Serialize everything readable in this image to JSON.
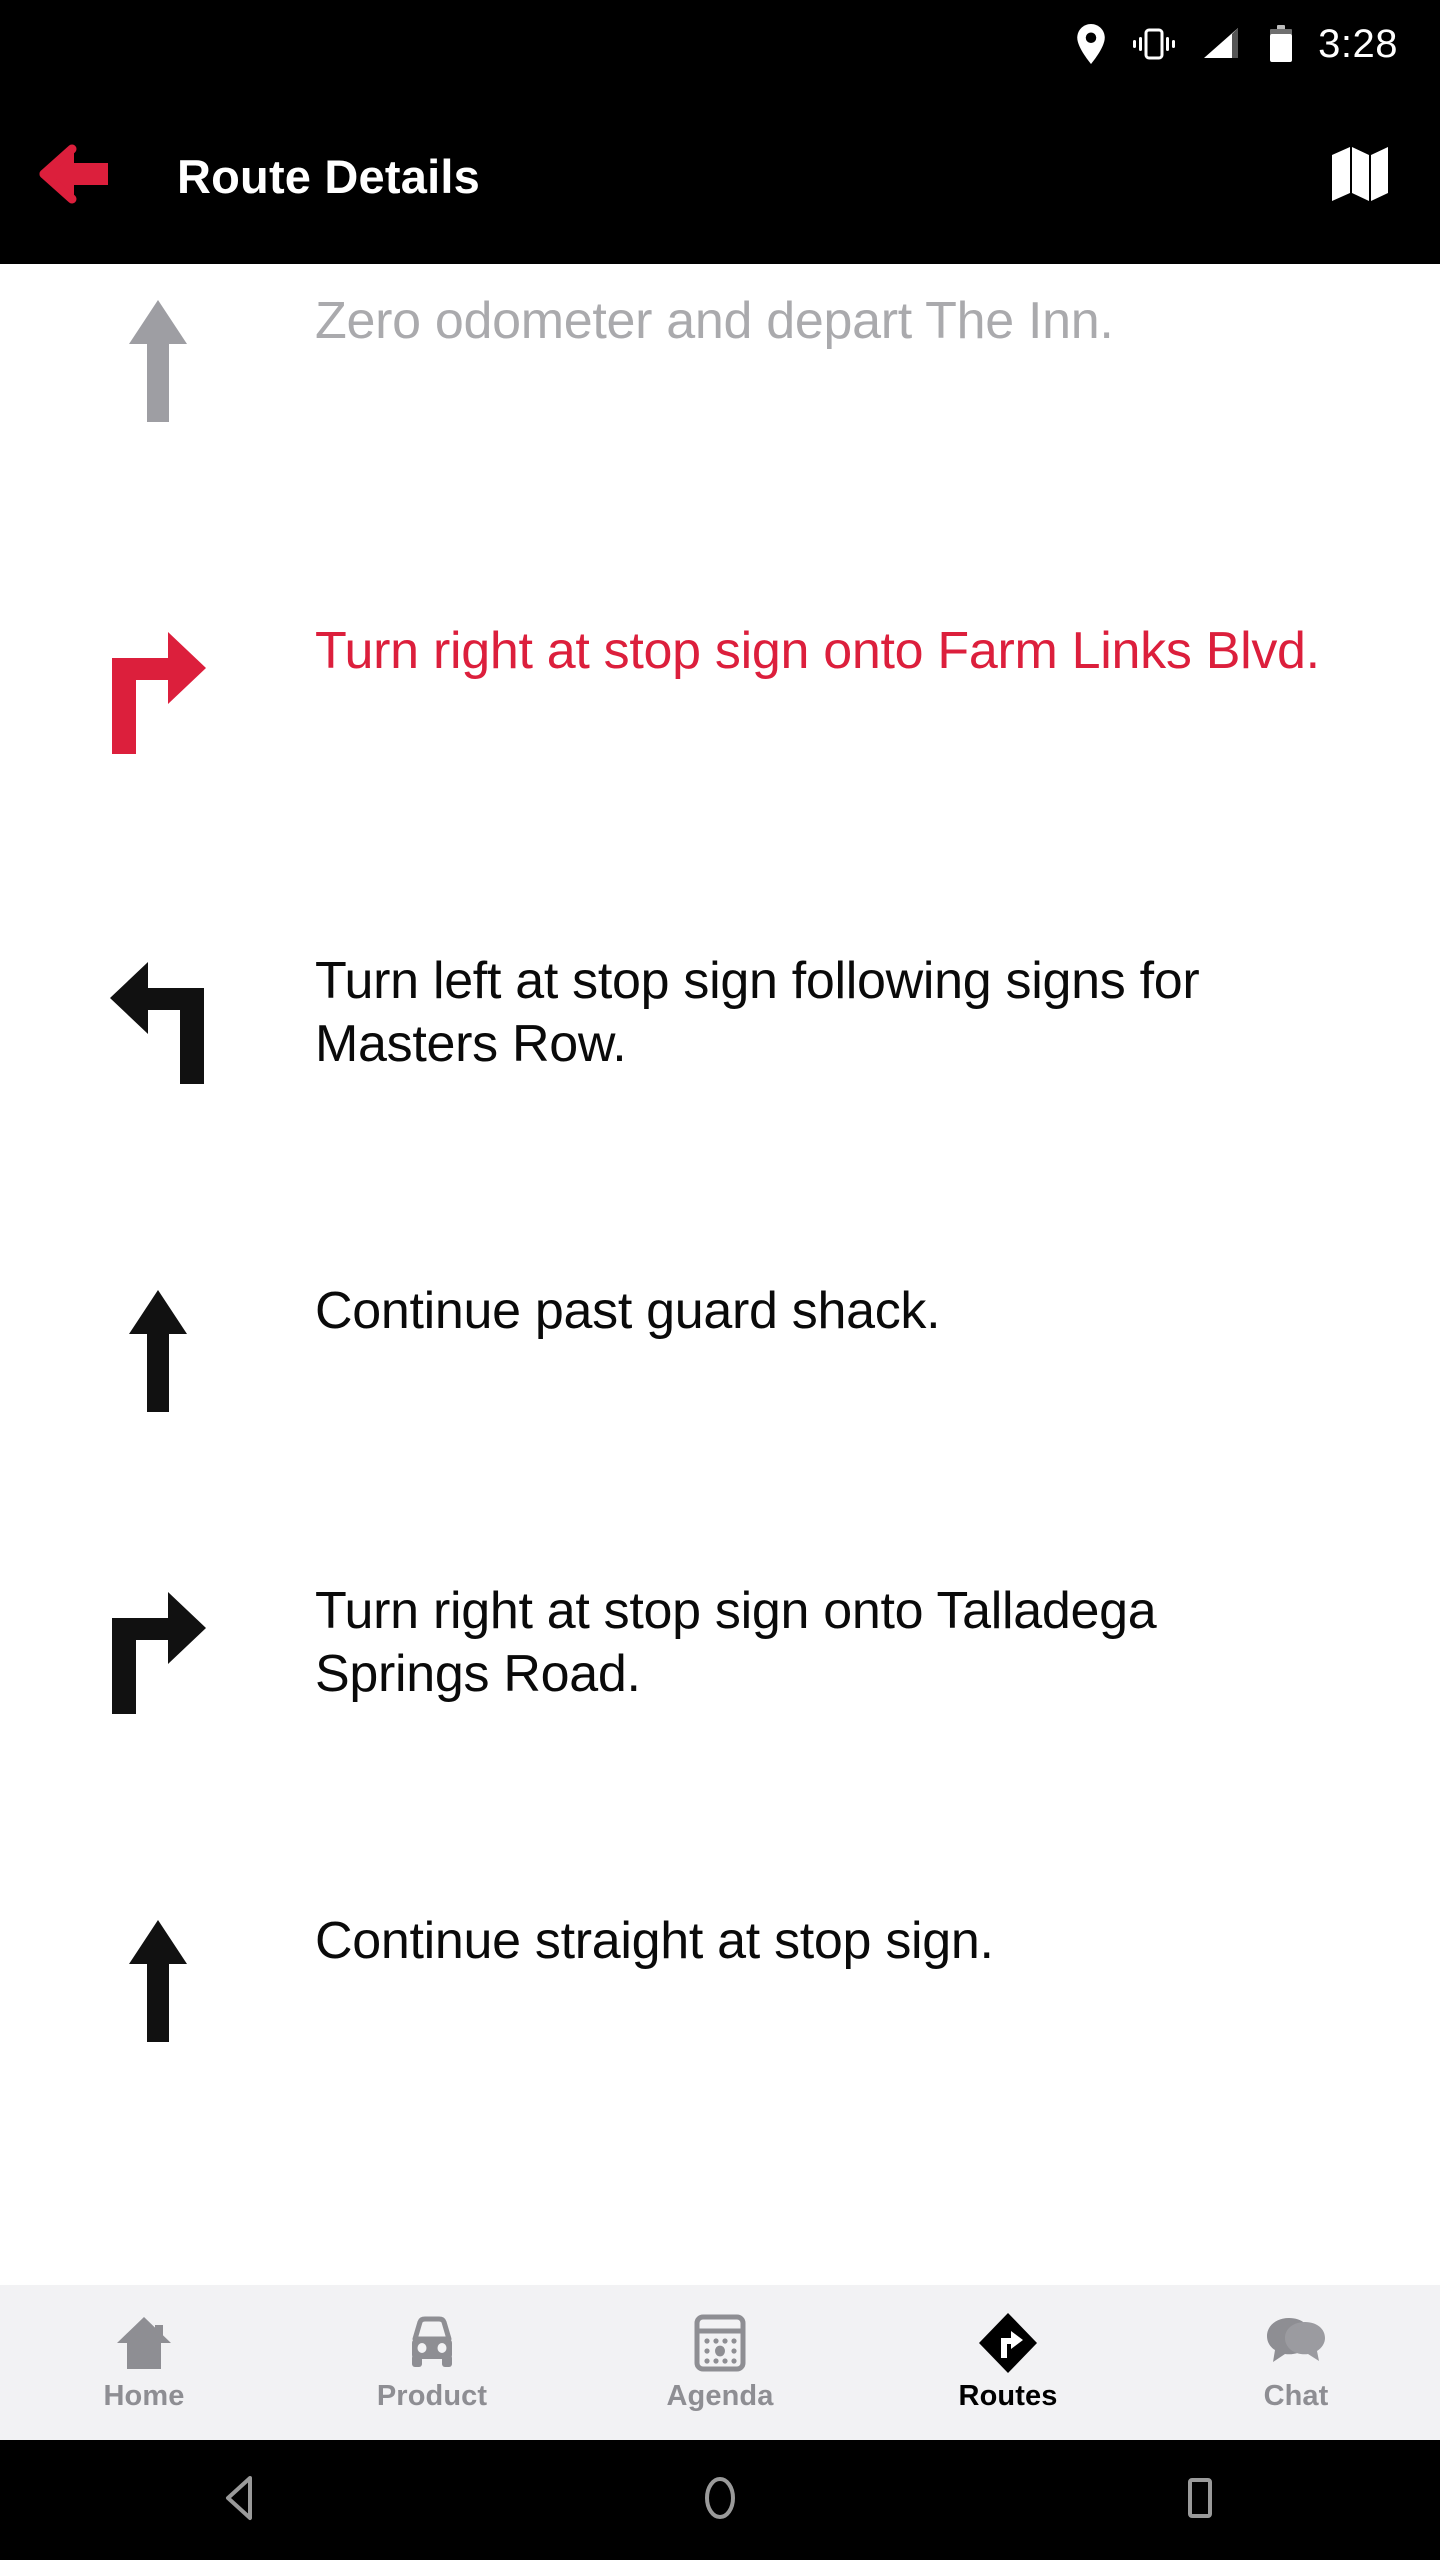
{
  "status_bar": {
    "time": "3:28",
    "icons": [
      "location-pin-icon",
      "vibrate-icon",
      "signal-icon",
      "battery-icon"
    ],
    "background_color": "#000000",
    "foreground_color": "#ffffff"
  },
  "app_bar": {
    "title": "Route Details",
    "back_icon": "back-arrow-icon",
    "action_icon": "map-icon",
    "background_color": "#000000",
    "title_color": "#ffffff",
    "back_icon_color": "#dc1f3c"
  },
  "theme": {
    "accent_red": "#dc1f3c",
    "pending_gray": "#aaaaad",
    "text_black": "#0a0a0a",
    "tab_bar_bg": "#f2f2f4",
    "tab_inactive": "#8e8e93"
  },
  "route": {
    "steps": [
      {
        "id": "step-1",
        "icon": "straight-arrow-icon",
        "text": "Zero odometer and depart The Inn.",
        "state": "pending",
        "color": "#aaaaad"
      },
      {
        "id": "step-2",
        "icon": "turn-right-arrow-icon",
        "text": "Turn right at stop sign onto Farm Links Blvd.",
        "state": "active",
        "color": "#dc1f3c"
      },
      {
        "id": "step-3",
        "icon": "turn-left-arrow-icon",
        "text": "Turn left at stop sign following signs for Masters Row.",
        "state": "normal",
        "color": "#0a0a0a"
      },
      {
        "id": "step-4",
        "icon": "straight-arrow-icon",
        "text": "Continue past guard shack.",
        "state": "normal",
        "color": "#0a0a0a"
      },
      {
        "id": "step-5",
        "icon": "turn-right-arrow-icon",
        "text": "Turn right at stop sign onto Talladega Springs Road.",
        "state": "normal",
        "color": "#0a0a0a"
      },
      {
        "id": "step-6",
        "icon": "straight-arrow-icon",
        "text": "Continue straight at stop sign.",
        "state": "normal",
        "color": "#0a0a0a"
      }
    ]
  },
  "tab_bar": {
    "tabs": [
      {
        "label": "Home",
        "icon": "home-icon",
        "active": false
      },
      {
        "label": "Product",
        "icon": "car-icon",
        "active": false
      },
      {
        "label": "Agenda",
        "icon": "calendar-icon",
        "active": false
      },
      {
        "label": "Routes",
        "icon": "routes-diamond-icon",
        "active": true
      },
      {
        "label": "Chat",
        "icon": "chat-bubbles-icon",
        "active": false
      }
    ]
  },
  "android_nav": {
    "buttons": [
      {
        "name": "back",
        "icon": "triangle-back-icon"
      },
      {
        "name": "home",
        "icon": "circle-home-icon"
      },
      {
        "name": "recents",
        "icon": "square-recents-icon"
      }
    ]
  }
}
